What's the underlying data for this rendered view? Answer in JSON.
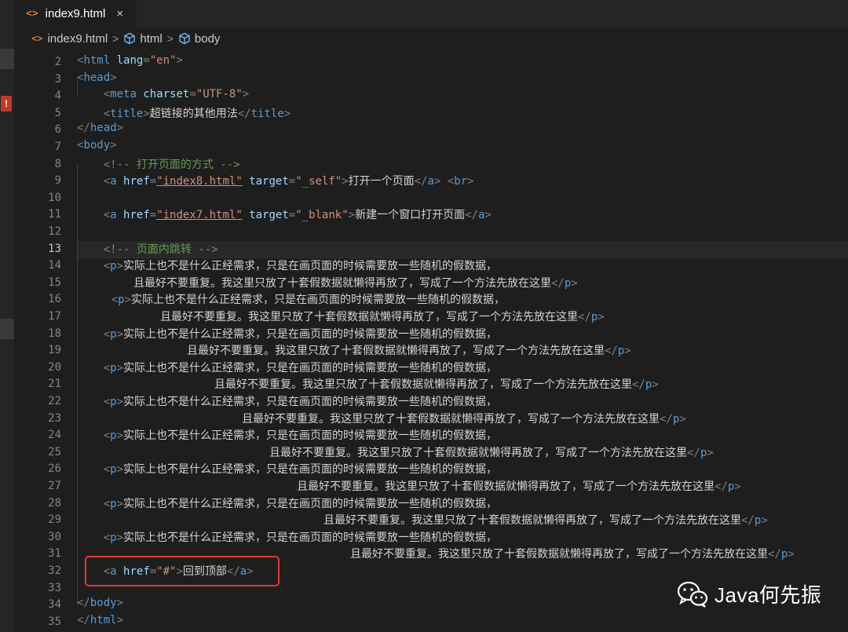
{
  "tab": {
    "icon": "html-angle-icon",
    "label": "index9.html",
    "close": "×"
  },
  "breadcrumb": {
    "file": "index9.html",
    "items": [
      "html",
      "body"
    ],
    "sep": ">"
  },
  "editor": {
    "active_line": 13,
    "line_numbers": [
      "2",
      "3",
      "4",
      "5",
      "6",
      "7",
      "8",
      "9",
      "10",
      "11",
      "12",
      "13",
      "14",
      "15",
      "16",
      "17",
      "18",
      "19",
      "20",
      "21",
      "22",
      "23",
      "24",
      "25",
      "26",
      "27",
      "28",
      "29",
      "30",
      "31",
      "32",
      "33",
      "34",
      "35"
    ],
    "tokens": {
      "html": "html",
      "lang": "lang",
      "en": "\"en\"",
      "head": "head",
      "meta": "meta",
      "charset": "charset",
      "utf8": "\"UTF-8\"",
      "title": "title",
      "title_text": "超链接的其他用法",
      "body": "body",
      "c1": "<!-- 打开页面的方式 -->",
      "c2": "<!-- 页面内跳转 -->",
      "a": "a",
      "href": "href",
      "target": "target",
      "i8": "\"index8.html\"",
      "i7": "\"index7.html\"",
      "self": "\"_self\"",
      "blank": "\"_blank\"",
      "link1": "打开一个页面",
      "br": "br",
      "link2": "新建一个窗口打开页面",
      "p": "p",
      "p_a": "实际上也不是什么正经需求，只是在画页面的时候需要放一些随机的假数据，",
      "p_b": "且最好不要重复。我这里只放了十套假数据就懒得再放了，写成了一个方法先放在这里",
      "hash": "\"#\"",
      "top": "回到顶部"
    }
  },
  "watermark": {
    "text": "Java何先振"
  }
}
